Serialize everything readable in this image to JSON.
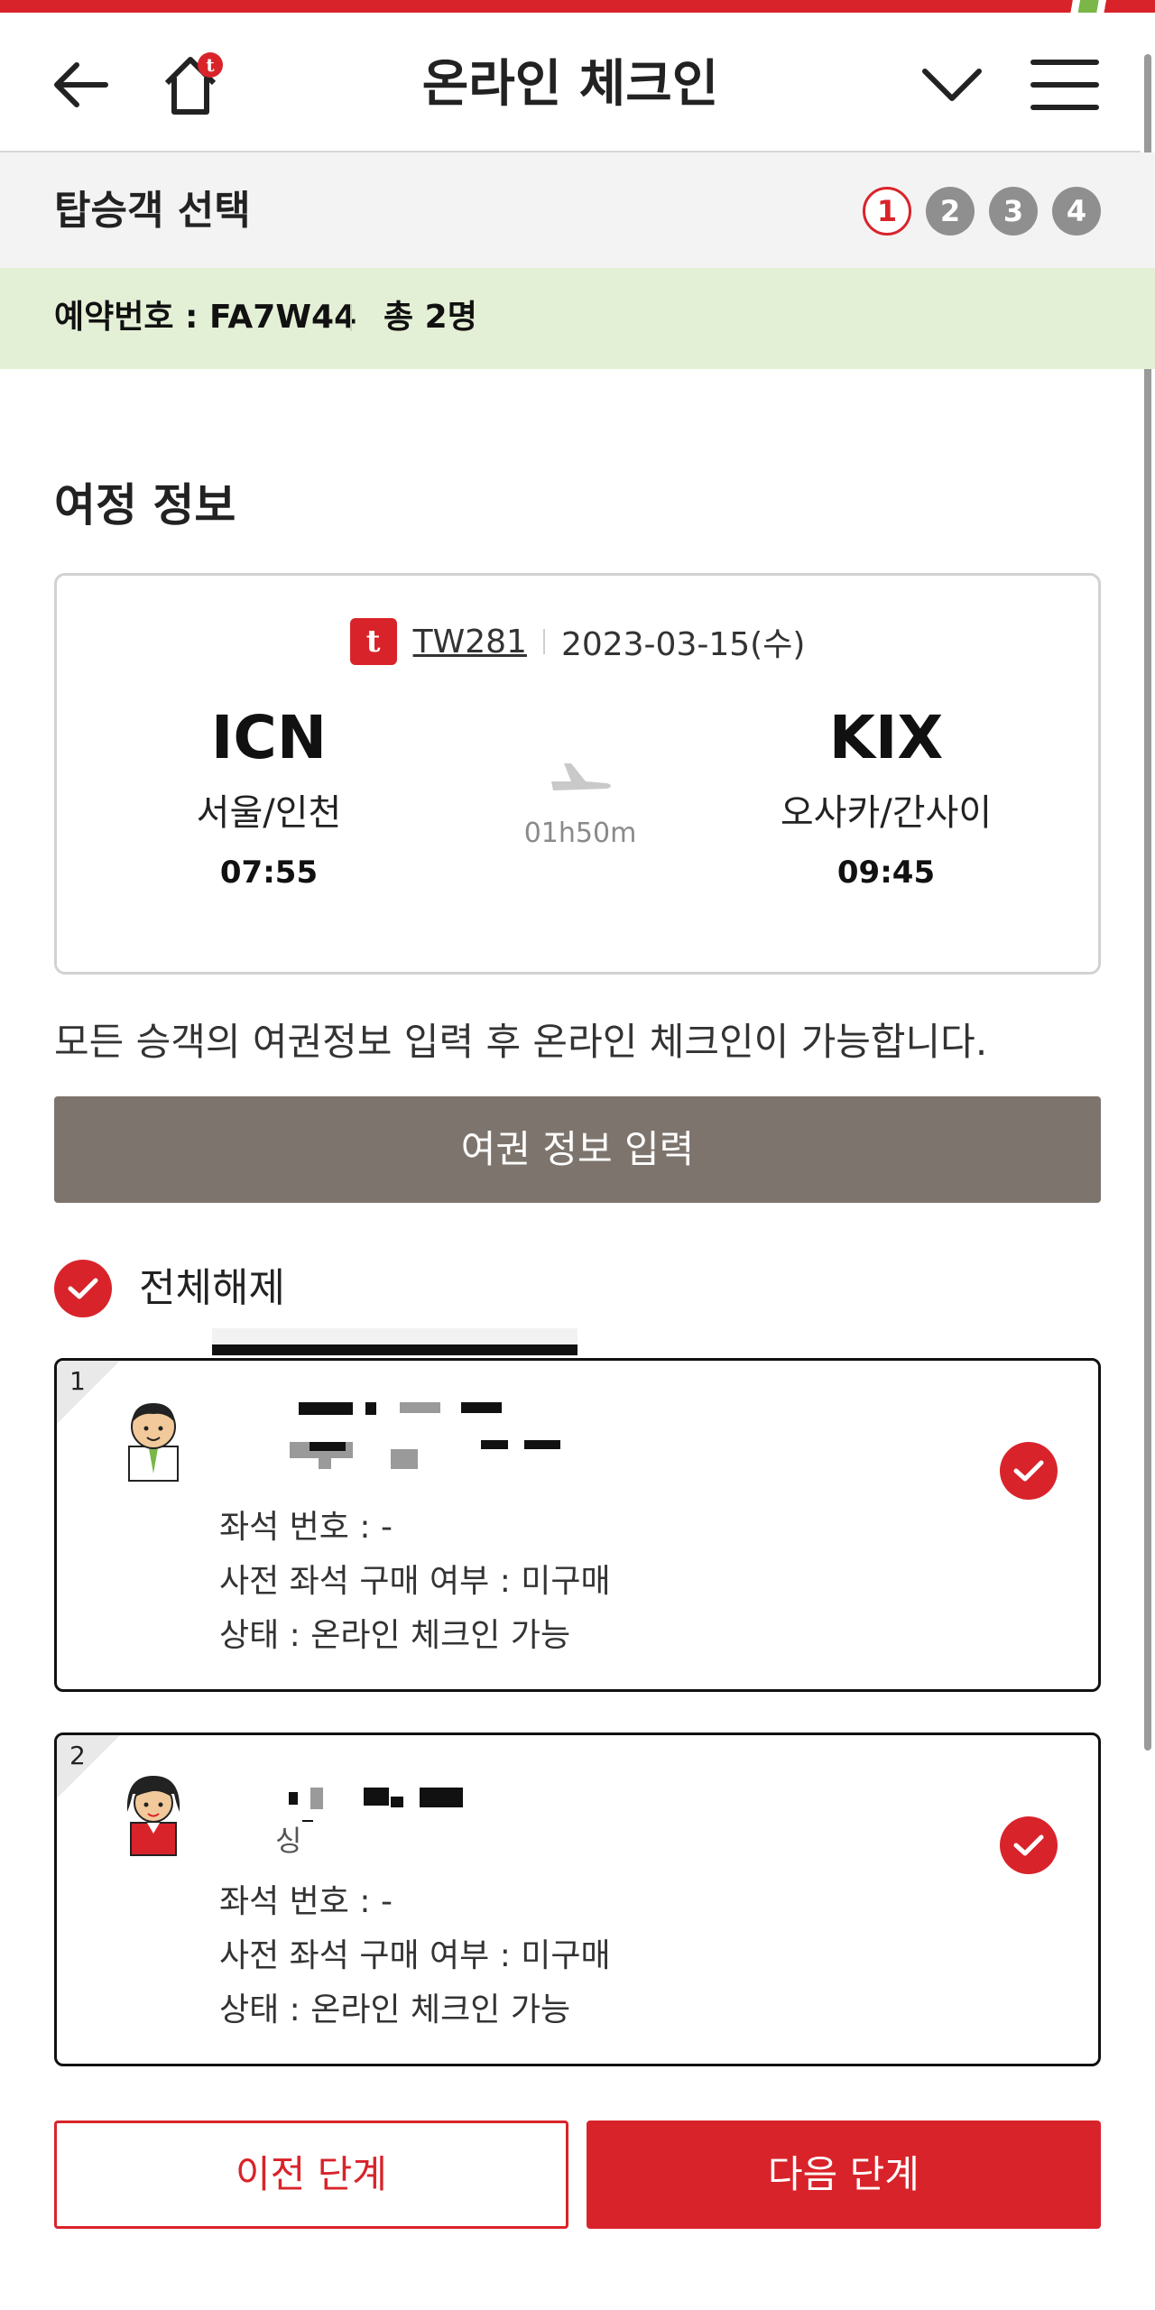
{
  "header": {
    "title": "온라인 체크인",
    "back_icon": "arrow-left-icon",
    "home_icon": "home-icon",
    "expand_icon": "chevron-down-icon",
    "menu_icon": "hamburger-menu-icon"
  },
  "stepbar": {
    "label": "탑승객 선택",
    "steps": [
      "1",
      "2",
      "3",
      "4"
    ],
    "active_step": "1"
  },
  "reservation": {
    "number_text": "예약번호 : FA7W44",
    "total_text": "총 2명"
  },
  "itinerary": {
    "section_title": "여정 정보",
    "flight_no": "TW281",
    "date": "2023-03-15(수)",
    "departure": {
      "code": "ICN",
      "city": "서울/인천",
      "time": "07:55"
    },
    "arrival": {
      "code": "KIX",
      "city": "오사카/간사이",
      "time": "09:45"
    },
    "duration": "01h50m"
  },
  "notice": "모든 승객의 여권정보 입력 후 온라인 체크인이 가능합니다.",
  "passport_button": "여권 정보 입력",
  "select_all": "전체해제",
  "passengers": [
    {
      "num": "1",
      "seat": "좌석 번호 : -",
      "prepaid": "사전 좌석 구매 여부 : 미구매",
      "status": "상태 : 온라인 체크인 가능"
    },
    {
      "num": "2",
      "fragment": "싱",
      "seat": "좌석 번호 : -",
      "prepaid": "사전 좌석 구매 여부 : 미구매",
      "status": "상태 : 온라인 체크인 가능"
    }
  ],
  "buttons": {
    "prev": "이전 단계",
    "next": "다음 단계"
  },
  "colors": {
    "brand_red": "#d9232a",
    "brand_green": "#7ab648",
    "reservation_bg": "#e4f0d6",
    "passport_btn_bg": "#7d746d"
  }
}
